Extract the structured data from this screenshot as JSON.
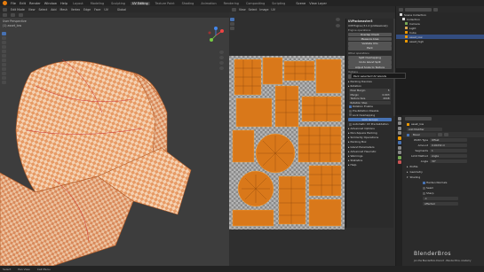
{
  "menubar": {
    "items": [
      "File",
      "Edit",
      "Render",
      "Window",
      "Help"
    ],
    "workspaces": [
      "Layout",
      "Modeling",
      "Sculpting",
      "UV Editing",
      "Texture Paint",
      "Shading",
      "Animation",
      "Rendering",
      "Compositing",
      "Scripting"
    ],
    "active_workspace": "UV Editing",
    "scene": "Scene",
    "view_layer": "View Layer"
  },
  "viewport": {
    "mode": "Edit Mode",
    "menu": [
      "View",
      "Select",
      "Add",
      "Mesh",
      "Vertex",
      "Edge",
      "Face",
      "UV"
    ],
    "overlay_label": "User Perspective",
    "object_label": "(1) asset_low",
    "transform": "Global"
  },
  "uv_editor": {
    "menu": [
      "View",
      "Select",
      "Image",
      "UV"
    ],
    "image_name": "UVPackmaster3",
    "panel": {
      "engine_title": "UVP Engine (3.1.2 (professional))",
      "engine_sub": "Engine operations",
      "buttons_top": [
        "Overlap Check",
        "Measure Area",
        "Validate UVs",
        "Pack"
      ],
      "other_ops_title": "Other operations",
      "other_buttons": [
        "Split Overlapping",
        "Undo Island Split",
        "Adjust Scale to Texture"
      ],
      "options_title": "Options",
      "scale_buttons": [
        "Scale Mode",
        "Scale Mode"
      ],
      "checks": [
        {
          "label": "Rotation Enable",
          "on": true
        },
        {
          "label": "Pre-Rotation Disable",
          "on": false
        },
        {
          "label": "Lock Overlapping",
          "on": false
        },
        {
          "label": "Advanced Island Options",
          "on": false
        }
      ],
      "sections": [
        "Packing Devices",
        "Rotation",
        "Heuristic"
      ],
      "fields": [
        {
          "label": "Pixel Margin",
          "value": "5"
        },
        {
          "label": "Margin",
          "value": "0.003"
        },
        {
          "label": "Texture Size",
          "value": "2048"
        }
      ],
      "lock_section": "Lock Groups",
      "rotation_section": "Rotation Step",
      "more_checks": [
        {
          "label": "Automatic UV Pre-Validation",
          "on": false
        }
      ],
      "sub_sections": [
        "Advanced Options",
        "Non-Square Packing",
        "Similarity Operations",
        "Packing Box",
        "Island Parameters",
        "Advanced Heuristic",
        "Warnings",
        "Statistics",
        "Help"
      ]
    },
    "tooltip": "Pack selected UV islands"
  },
  "outliner": {
    "title": "Scene Collection",
    "rows": [
      {
        "label": "Scene Collection",
        "selected": false
      },
      {
        "label": "Collection",
        "selected": false
      },
      {
        "label": "Camera",
        "selected": false
      },
      {
        "label": "Light",
        "selected": false
      },
      {
        "label": "Cube",
        "selected": false
      },
      {
        "label": "asset_low",
        "selected": true
      },
      {
        "label": "asset_high",
        "selected": false
      }
    ]
  },
  "properties": {
    "object": "asset_low",
    "add_modifier": "Add Modifier",
    "modifier_name": "Bevel",
    "rows": [
      {
        "label": "Width Type",
        "value": "Offset"
      },
      {
        "label": "Amount",
        "value": "0.00232 m"
      },
      {
        "label": "Segments",
        "value": "1"
      },
      {
        "label": "Limit Method",
        "value": "Angle"
      },
      {
        "label": "Angle",
        "value": "30°"
      }
    ],
    "sections": [
      "Profile",
      "Geometry",
      "Shading"
    ],
    "shading": {
      "harden": "Harden Normals",
      "mark_seam": "Seam",
      "mark_sharp": "Sharp",
      "material_index": "-1",
      "face_strength": "Affected"
    }
  },
  "watermark": {
    "brand": "BlenderBros",
    "url": "Join the BlenderBros Discord - Blender Bros. Academy"
  },
  "statusbar": {
    "left": "Select",
    "mid": "Pan View",
    "right": "Call Menu"
  },
  "colors": {
    "accent": "#4772b3",
    "mesh_orange": "#e8a070",
    "uv_orange": "#d9781a",
    "selected_row": "#334d80"
  }
}
